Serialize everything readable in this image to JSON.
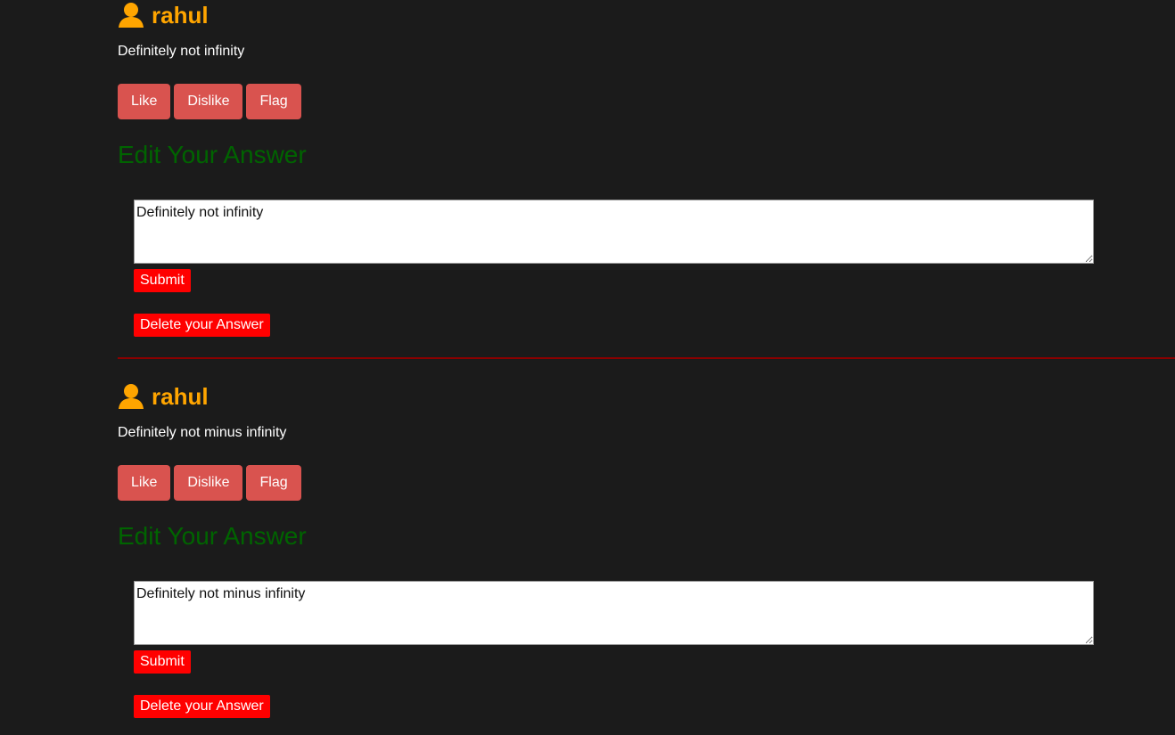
{
  "answers": [
    {
      "author": "rahul",
      "text": "Definitely not infinity",
      "actions": {
        "like": "Like",
        "dislike": "Dislike",
        "flag": "Flag"
      },
      "edit": {
        "heading": "Edit Your Answer",
        "value": "Definitely not infinity",
        "submit": "Submit",
        "delete": "Delete your Answer"
      }
    },
    {
      "author": "rahul",
      "text": "Definitely not minus infinity",
      "actions": {
        "like": "Like",
        "dislike": "Dislike",
        "flag": "Flag"
      },
      "edit": {
        "heading": "Edit Your Answer",
        "value": "Definitely not minus infinity",
        "submit": "Submit",
        "delete": "Delete your Answer"
      }
    }
  ],
  "icons": {
    "author": "user-icon"
  },
  "colors": {
    "background": "#1b1b1b",
    "author_name": "#ffa500",
    "vote_button": "#d9534f",
    "edit_heading": "#006400",
    "action_button": "#ff0000",
    "divider": "#8b0000"
  }
}
